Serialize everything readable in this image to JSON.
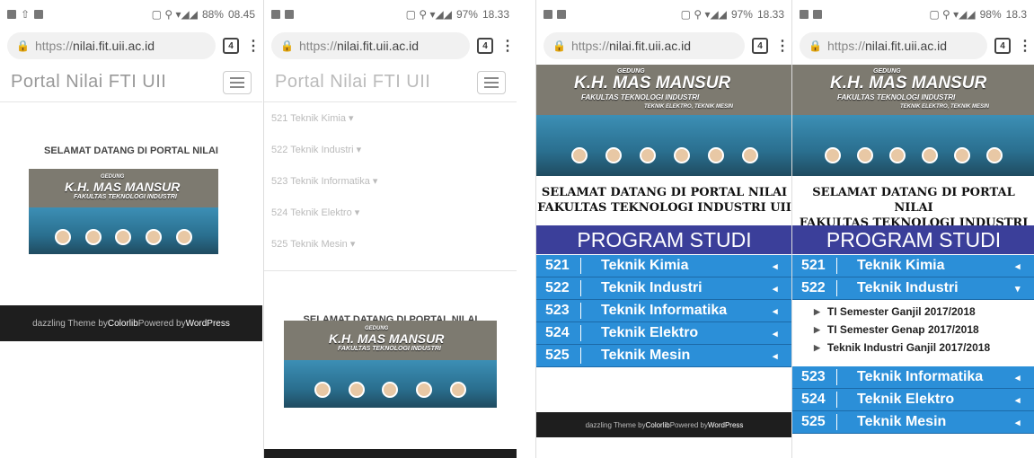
{
  "phones": [
    {
      "status_left_icons": [
        "sim-icon",
        "upload-icon",
        "image-icon"
      ],
      "time": "08.45",
      "battery": "88%"
    },
    {
      "time": "18.33",
      "battery": "97%"
    },
    {
      "time": "18.33",
      "battery": "97%"
    },
    {
      "time": "18.3",
      "battery": "98%"
    }
  ],
  "browser": {
    "url_scheme": "https://",
    "url_host": "nilai.fit.uii.ac.id",
    "tab_count": "4"
  },
  "site": {
    "brand": "Portal Nilai FTI UII",
    "welcome": "SELAMAT DATANG DI PORTAL NILAI",
    "banner_top": "GEDUNG",
    "banner_name": "K.H. MAS MANSUR",
    "banner_fak": "FAKULTAS TEKNOLOGI INDUSTRI",
    "banner_sub": "TEKNIK ELEKTRO, TEKNIK MESIN",
    "footer_prefix": "dazzling Theme by ",
    "footer_colorlib": "Colorlib",
    "footer_powered": " Powered by ",
    "footer_wp": "WordPress"
  },
  "menu": [
    "521 Teknik Kimia ▾",
    "522 Teknik Industri ▾",
    "523 Teknik Informatika ▾",
    "524 Teknik Elektro ▾",
    "525 Teknik Mesin ▾"
  ],
  "poster": {
    "headline1": "SELAMAT DATANG DI PORTAL NILAI",
    "headline2": "FAKULTAS TEKNOLOGI INDUSTRI UII",
    "program": "PROGRAM STUDI"
  },
  "prodi": [
    {
      "num": "521",
      "name": "Teknik Kimia"
    },
    {
      "num": "522",
      "name": "Teknik Industri"
    },
    {
      "num": "523",
      "name": "Teknik Informatika"
    },
    {
      "num": "524",
      "name": "Teknik Elektro"
    },
    {
      "num": "525",
      "name": "Teknik Mesin"
    }
  ],
  "industri_sub": [
    "TI Semester Ganjil 2017/2018",
    "TI Semester Genap 2017/2018",
    "Teknik Industri Ganjil 2017/2018"
  ],
  "arrows": {
    "collapsed": "◂",
    "expanded": "▾"
  },
  "colors": {
    "prodi_blue": "#2b8fd8",
    "program_header": "#3b3f9a",
    "footer_bg": "#1e1e1e"
  }
}
